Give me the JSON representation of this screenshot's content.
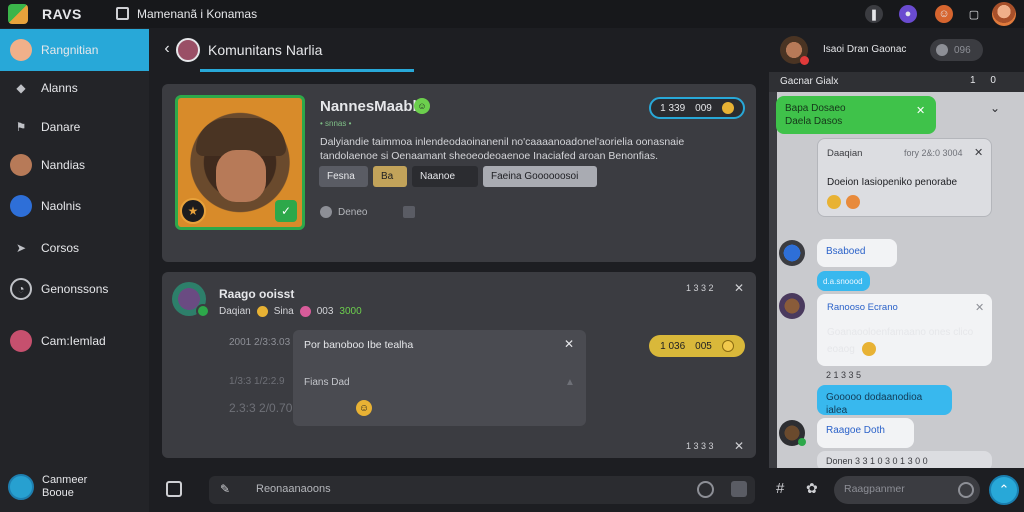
{
  "app": {
    "brand": "RAVS",
    "window_title": "Mamenanã i Konamas"
  },
  "topbar": {
    "icons": [
      "pause-icon",
      "user-badge-icon",
      "emoji-icon",
      "window-icon",
      "avatar"
    ]
  },
  "sidebar": {
    "items": [
      {
        "label": "Rangnitian",
        "icon": "avatar-icon",
        "active": true
      },
      {
        "label": "Alanns",
        "icon": "shield-icon"
      },
      {
        "label": "Danare",
        "icon": "network-icon"
      },
      {
        "label": "Nandias",
        "icon": "avatar-icon"
      },
      {
        "label": "Naolnis",
        "icon": "avatar-icon"
      },
      {
        "label": "Corsos",
        "icon": "send-icon"
      },
      {
        "label": "Genonssons",
        "icon": "clock-icon"
      },
      {
        "label": "Cam:Iemlad",
        "icon": "avatar-icon"
      }
    ],
    "user": {
      "line1": "Canmeer",
      "line2": "Booue"
    }
  },
  "channel": {
    "title": "Komunitans Narlia"
  },
  "profile": {
    "name": "NannesMaabh",
    "sub": "• snnas •",
    "bio": "Dalyiandie taimmoa inlendeodaoinanenil no'caaaanoadonel'aorielia oonasnaie tandolaenoe si Oenaamant sheoeodeoaenoe Inaciafed aroan Benonfias.",
    "buttons": [
      "Fesna",
      "Ba",
      "Naanoe",
      "Faeina Goooooosoi"
    ],
    "meta": "Deneo",
    "stat": {
      "a": "1 339",
      "b": "009"
    }
  },
  "group": {
    "title": "Raago ooisst",
    "sub_prefix": "Daqian",
    "sub_mid": "Sina",
    "sub_suffix": "003",
    "sub_green": "3000",
    "time": "1 3 3 2",
    "timestamps": [
      "2001 2/3:3.03",
      "1/3:3 1/2:2.9",
      "2.3:3 2/0.70"
    ],
    "inner": {
      "title": "Por banoboo Ibe tealha",
      "label": "Fians Dad"
    },
    "reaction": {
      "a": "1 036",
      "b": "005"
    },
    "foot_time": "1 3 3 3"
  },
  "composer": {
    "placeholder": "Reonaanaoons"
  },
  "right": {
    "header_name": "Isaoi Dran Gaonac",
    "toggle_label": "096",
    "panel_title": "Gacnar Gialx",
    "panel_ctrl": "1 0",
    "messages": [
      {
        "head": "Bapa Dosaeo",
        "body": "Daela Dasos"
      },
      {
        "head": "Daaqian",
        "time": "fory 2&:0 3004",
        "body": "Doeion Iasiopeniko penorabe"
      },
      {
        "body": "Bsaboed"
      },
      {
        "body": "d.a.snoood"
      },
      {
        "head": "Ranooso Ecrano",
        "body": "Goanaooloenfamaano ones clico eoaog"
      },
      {
        "body": "Gooooo dodaanodioa ialea"
      },
      {
        "body": "Raagoe Doth"
      },
      {
        "body": "Donen 3 3 1 0 3 0 1 3 0 0"
      }
    ],
    "ts": "2 1 3 3 5",
    "composer_placeholder": "Raagpanmer"
  },
  "colors": {
    "accent": "#28a8d8",
    "green": "#3fc24a",
    "gold": "#d9b83a"
  }
}
